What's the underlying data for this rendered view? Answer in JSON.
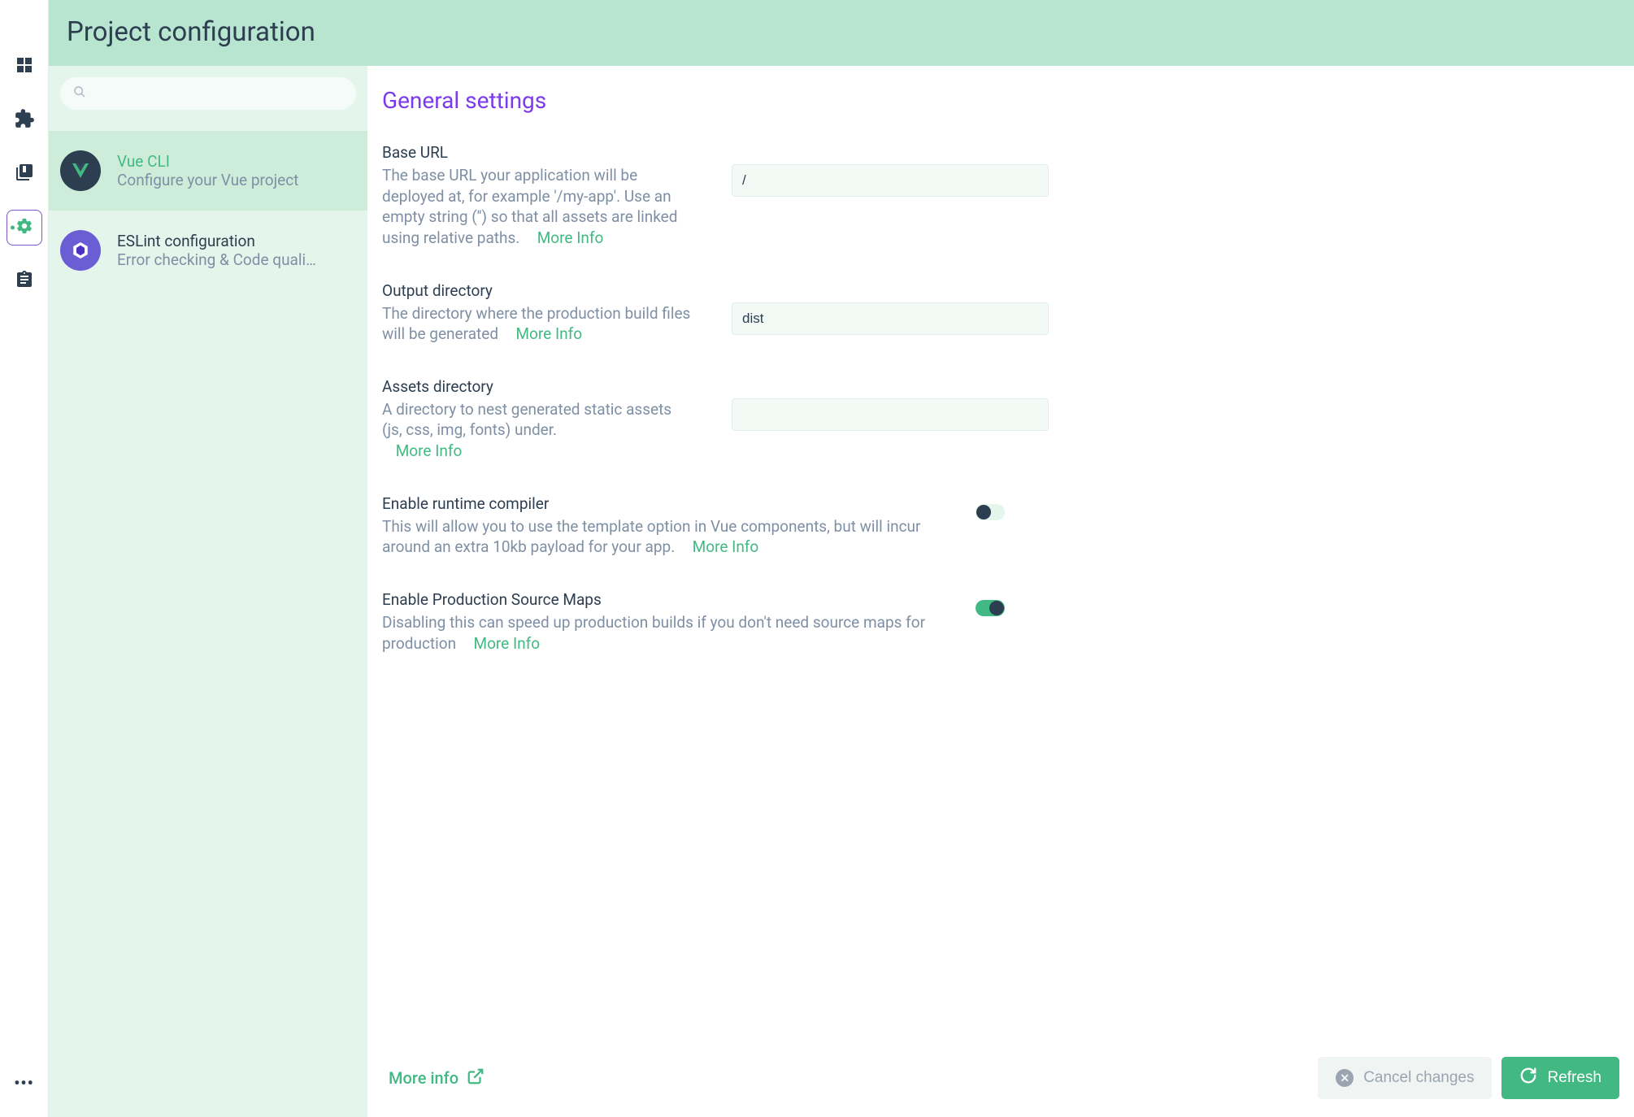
{
  "header": {
    "title": "Project configuration"
  },
  "nav": {
    "items": [
      {
        "name": "dashboard-icon"
      },
      {
        "name": "plugins-icon"
      },
      {
        "name": "dependencies-icon"
      },
      {
        "name": "configuration-icon",
        "active": true
      },
      {
        "name": "tasks-icon"
      }
    ]
  },
  "search": {
    "placeholder": ""
  },
  "configList": [
    {
      "key": "vue-cli",
      "title": "Vue CLI",
      "subtitle": "Configure your Vue project",
      "selected": true
    },
    {
      "key": "eslint",
      "title": "ESLint configuration",
      "subtitle": "Error checking & Code quali…",
      "selected": false
    }
  ],
  "settings": {
    "sectionTitle": "General settings",
    "moreInfoLabel": "More Info",
    "fields": {
      "baseUrl": {
        "label": "Base URL",
        "description": "The base URL your application will be deployed at, for example '/my-app'. Use an empty string ('') so that all assets are linked using relative paths.",
        "value": "/"
      },
      "outputDir": {
        "label": "Output directory",
        "description": "The directory where the production build files will be generated",
        "value": "dist"
      },
      "assetsDir": {
        "label": "Assets directory",
        "description": "A directory to nest generated static assets (js, css, img, fonts) under.",
        "value": ""
      },
      "runtimeCompiler": {
        "label": "Enable runtime compiler",
        "description": "This will allow you to use the template option in Vue components, but will incur around an extra 10kb payload for your app.",
        "value": false
      },
      "productionSourceMap": {
        "label": "Enable Production Source Maps",
        "description": "Disabling this can speed up production builds if you don't need source maps for production",
        "value": true
      }
    }
  },
  "footer": {
    "moreInfo": "More info",
    "cancel": "Cancel changes",
    "refresh": "Refresh"
  }
}
